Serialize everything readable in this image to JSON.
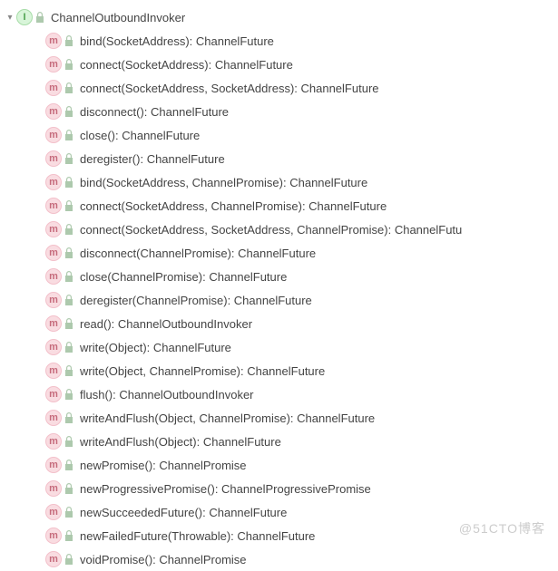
{
  "header": {
    "badge_letter": "I",
    "name": "ChannelOutboundInvoker"
  },
  "method_badge_letter": "m",
  "methods": [
    "bind(SocketAddress): ChannelFuture",
    "connect(SocketAddress): ChannelFuture",
    "connect(SocketAddress, SocketAddress): ChannelFuture",
    "disconnect(): ChannelFuture",
    "close(): ChannelFuture",
    "deregister(): ChannelFuture",
    "bind(SocketAddress, ChannelPromise): ChannelFuture",
    "connect(SocketAddress, ChannelPromise): ChannelFuture",
    "connect(SocketAddress, SocketAddress, ChannelPromise): ChannelFutu",
    "disconnect(ChannelPromise): ChannelFuture",
    "close(ChannelPromise): ChannelFuture",
    "deregister(ChannelPromise): ChannelFuture",
    "read(): ChannelOutboundInvoker",
    "write(Object): ChannelFuture",
    "write(Object, ChannelPromise): ChannelFuture",
    "flush(): ChannelOutboundInvoker",
    "writeAndFlush(Object, ChannelPromise): ChannelFuture",
    "writeAndFlush(Object): ChannelFuture",
    "newPromise(): ChannelPromise",
    "newProgressivePromise(): ChannelProgressivePromise",
    "newSucceededFuture(): ChannelFuture",
    "newFailedFuture(Throwable): ChannelFuture",
    "voidPromise(): ChannelPromise"
  ],
  "watermark": "@51CTO博客"
}
